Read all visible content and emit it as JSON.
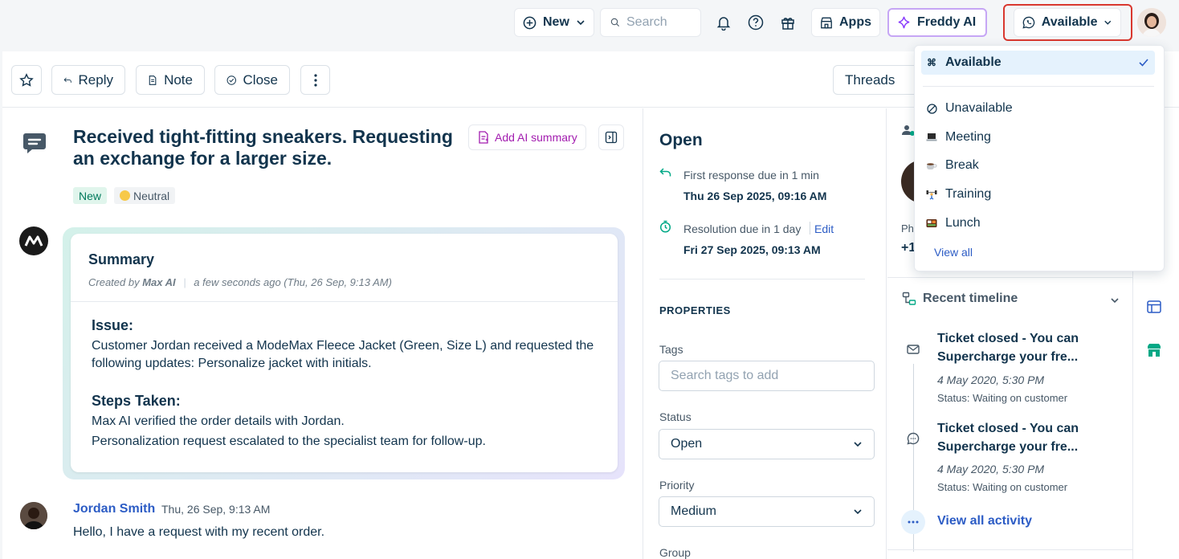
{
  "topbar": {
    "new_label": "New",
    "search_placeholder": "Search",
    "apps_label": "Apps",
    "freddy_label": "Freddy AI",
    "availability_label": "Available"
  },
  "toolbar": {
    "reply_label": "Reply",
    "note_label": "Note",
    "close_label": "Close",
    "threads_label": "Threads"
  },
  "ticket": {
    "title": "Received tight-fitting sneakers. Requesting an exchange for a larger size.",
    "add_ai_summary": "Add AI summary",
    "status_badge": "New",
    "sentiment": "Neutral",
    "summary": {
      "heading": "Summary",
      "created_by_prefix": "Created by",
      "created_by": "Max AI",
      "created_time": "a few seconds ago (Thu, 26 Sep, 9:13 AM)",
      "issue_heading": "Issue:",
      "issue_text": "Customer Jordan received a ModeMax Fleece Jacket (Green, Size L) and requested the following updates: Personalize jacket with initials.",
      "steps_heading": "Steps Taken:",
      "step_1": "Max AI verified the order details with Jordan.",
      "step_2": "Personalization request escalated to the specialist team for follow-up."
    },
    "message": {
      "author": "Jordan Smith",
      "time": "Thu, 26 Sep, 9:13 AM",
      "text": "Hello, I have a request with my recent order."
    }
  },
  "properties_panel": {
    "status_heading": "Open",
    "first_response_label": "First response due in 1 min",
    "first_response_date": "Thu 26 Sep 2025, 09:16 AM",
    "resolution_label": "Resolution due in 1 day",
    "edit_label": "Edit",
    "resolution_date": "Fri 27 Sep 2025, 09:13 AM",
    "properties_title": "PROPERTIES",
    "tags_label": "Tags",
    "tags_placeholder": "Search tags to add",
    "status_label": "Status",
    "status_value": "Open",
    "priority_label": "Priority",
    "priority_value": "Medium",
    "group_label": "Group"
  },
  "contact_panel": {
    "phone_label_partial": "Pho",
    "phone_value_partial": "+1",
    "timeline_title": "Recent timeline",
    "items": [
      {
        "title": "Ticket closed - You can Supercharge your fre...",
        "date": "4 May 2020, 5:30 PM",
        "status": "Status: Waiting on customer"
      },
      {
        "title": "Ticket closed - You can Supercharge your fre...",
        "date": "4 May 2020, 5:30 PM",
        "status": "Status: Waiting on customer"
      }
    ],
    "view_all_activity": "View all activity"
  },
  "availability_dropdown": {
    "items": [
      {
        "label": "Available",
        "icon": "command-icon",
        "selected": true
      },
      {
        "label": "Unavailable",
        "icon": "unavailable-icon"
      },
      {
        "label": "Meeting",
        "icon": "laptop-emoji"
      },
      {
        "label": "Break",
        "icon": "coffee-emoji"
      },
      {
        "label": "Training",
        "icon": "weightlifter-emoji"
      },
      {
        "label": "Lunch",
        "icon": "bento-emoji"
      }
    ],
    "view_all": "View all"
  },
  "colors": {
    "primary_text": "#12344d",
    "link": "#2c5cc5",
    "highlight_border": "#d9382f",
    "freddy_border": "#c6a6f5",
    "ai_accent": "#a21caf"
  }
}
